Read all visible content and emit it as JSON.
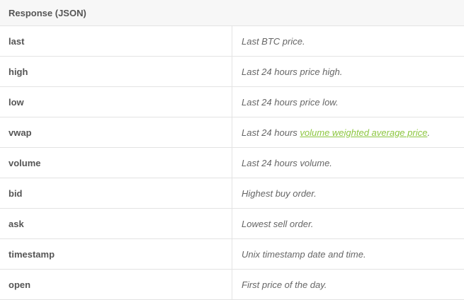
{
  "header": {
    "title": "Response (JSON)"
  },
  "rows": [
    {
      "field": "last",
      "description": "Last BTC price."
    },
    {
      "field": "high",
      "description": "Last 24 hours price high."
    },
    {
      "field": "low",
      "description": "Last 24 hours price low."
    },
    {
      "field": "vwap",
      "description_before": "Last 24 hours ",
      "link_text": "volume weighted average price",
      "description_after": "."
    },
    {
      "field": "volume",
      "description": "Last 24 hours volume."
    },
    {
      "field": "bid",
      "description": "Highest buy order."
    },
    {
      "field": "ask",
      "description": "Lowest sell order."
    },
    {
      "field": "timestamp",
      "description": "Unix timestamp date and time."
    },
    {
      "field": "open",
      "description": "First price of the day."
    }
  ],
  "colors": {
    "link": "#8cc63f",
    "border": "#e3e3e3",
    "header_bg": "#f7f7f7",
    "text": "#555555"
  }
}
